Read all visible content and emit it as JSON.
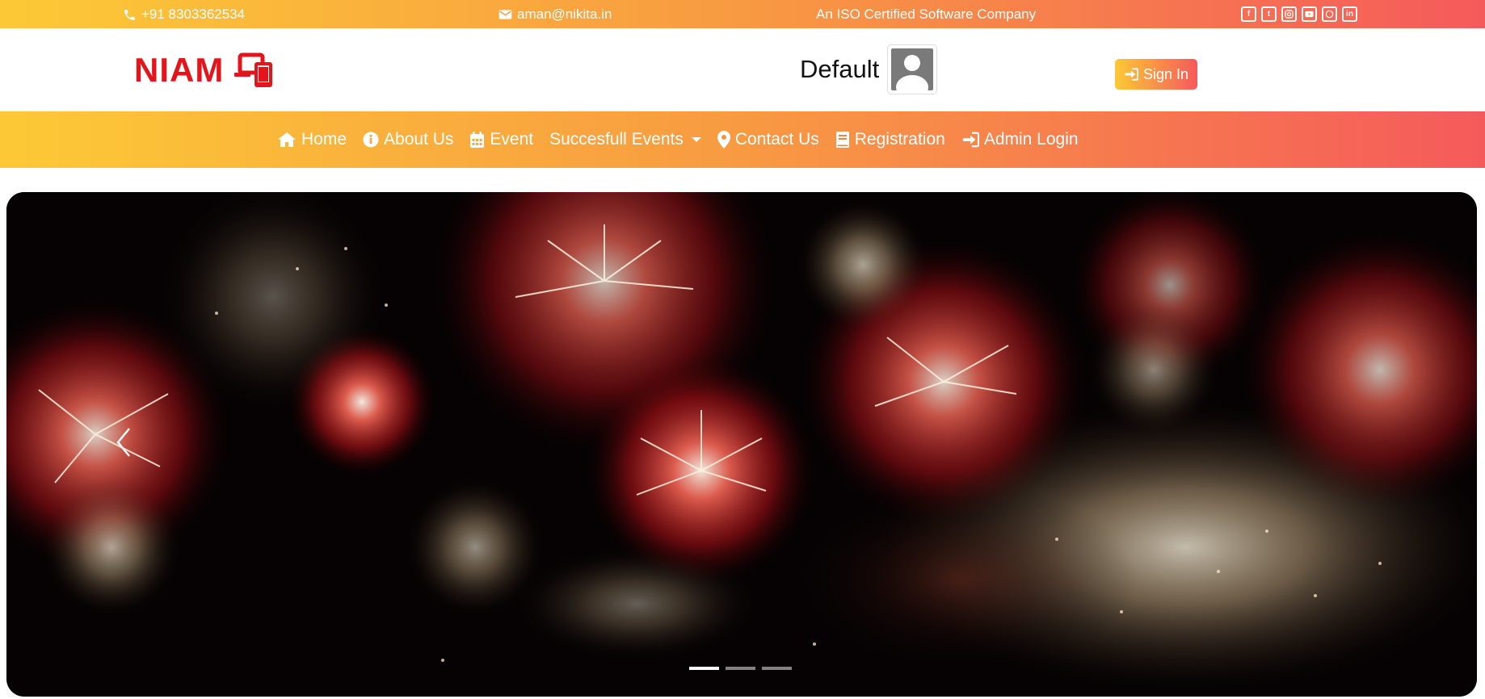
{
  "topbar": {
    "phone": "+91 8303362534",
    "email": "aman@nikita.in",
    "tagline": "An ISO Certified Software Company",
    "socials": [
      "facebook-icon",
      "twitter-icon",
      "instagram-icon",
      "youtube-icon",
      "whatsapp-icon",
      "linkedin-icon"
    ]
  },
  "header": {
    "logo_text": "NIAM",
    "user_name": "Default",
    "signin_label": "Sign In"
  },
  "nav": {
    "items": [
      {
        "label": "Home",
        "icon": "home-icon"
      },
      {
        "label": "About Us",
        "icon": "info-icon"
      },
      {
        "label": "Event",
        "icon": "calendar-icon"
      },
      {
        "label": "Succesfull Events",
        "icon": "dropdown-caret"
      },
      {
        "label": "Contact Us",
        "icon": "map-marker-icon"
      },
      {
        "label": "Registration",
        "icon": "book-icon"
      },
      {
        "label": "Admin Login",
        "icon": "sign-in-icon"
      }
    ]
  },
  "carousel": {
    "slide_count": 3,
    "active_slide": 1
  },
  "colors": {
    "gradient_start": "#fcc936",
    "gradient_end": "#f55a5b",
    "logo_red": "#e3141b"
  }
}
